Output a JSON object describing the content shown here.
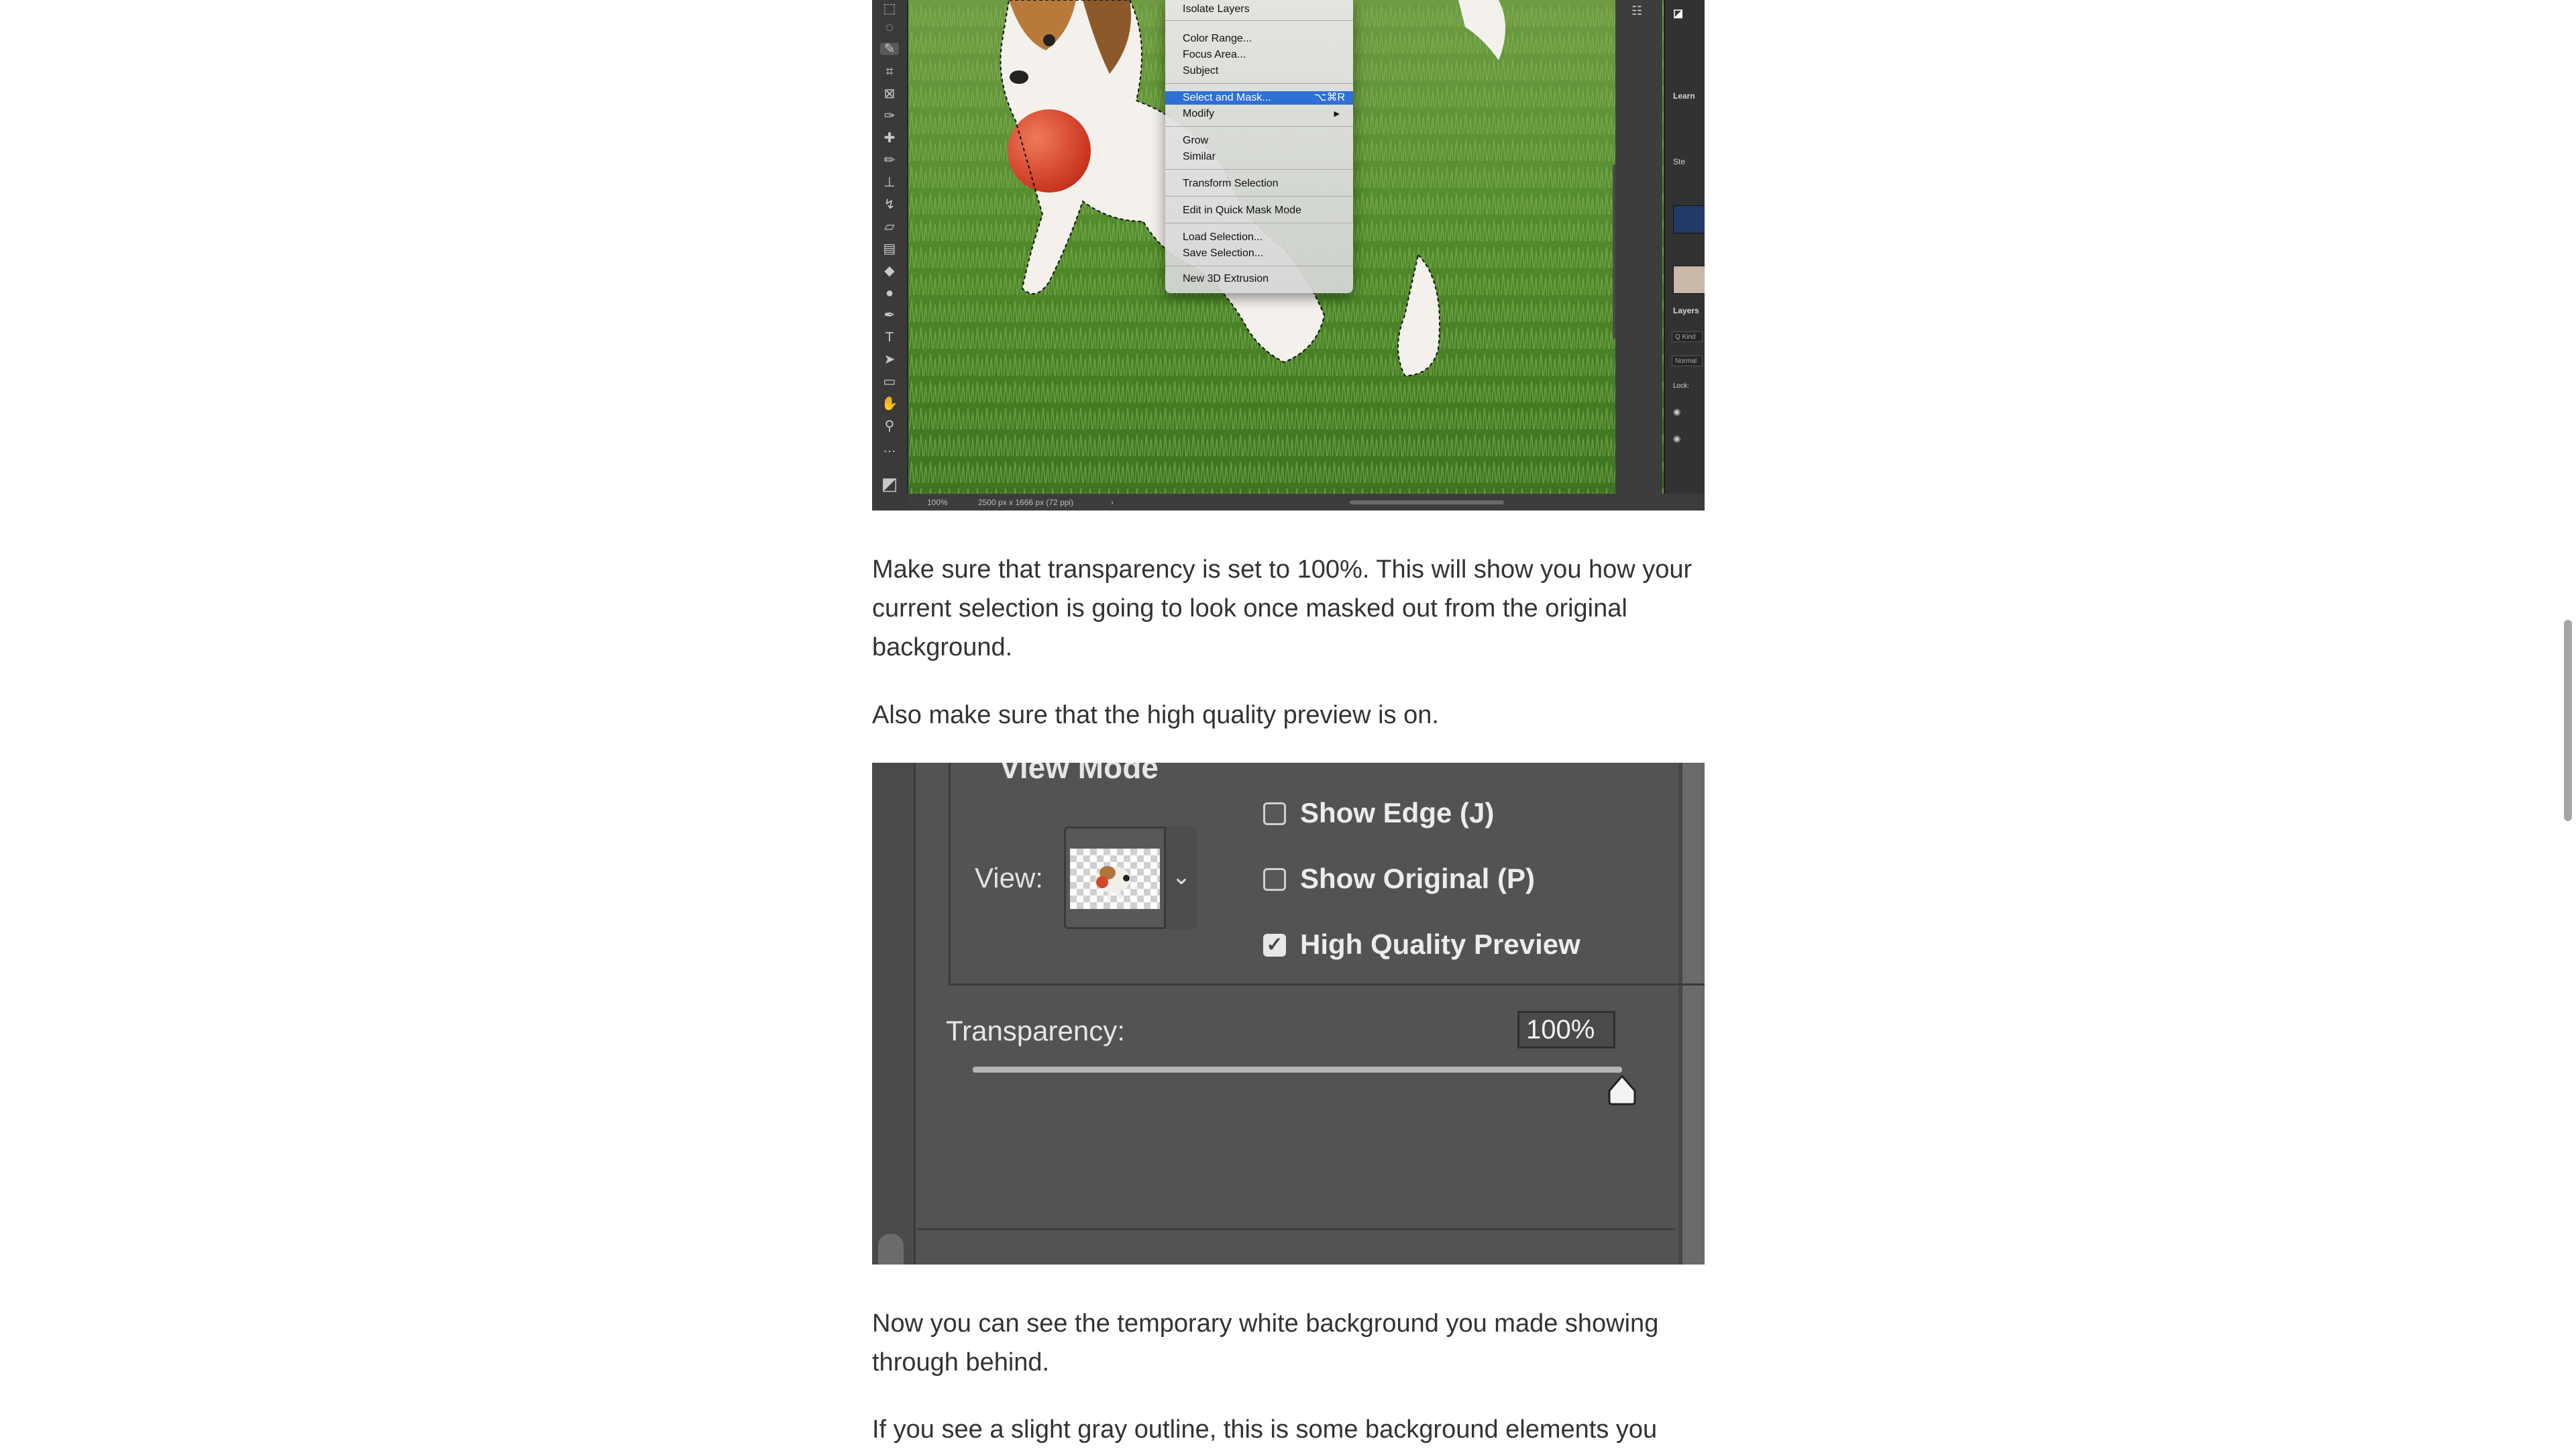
{
  "screenshot1": {
    "select_menu": {
      "items": [
        "Isolate Layers",
        "Color Range...",
        "Focus Area...",
        "Subject",
        "Select and Mask...",
        "Modify",
        "Grow",
        "Similar",
        "Transform Selection",
        "Edit in Quick Mask Mode",
        "Load Selection...",
        "Save Selection...",
        "New 3D Extrusion"
      ],
      "highlighted_shortcut": "⌥⌘R",
      "submenu_arrow": "▶"
    },
    "statusbar": {
      "zoom": "100%",
      "doc_info": "2500 px x 1666 px (72 ppi)",
      "arrow": "›"
    },
    "right_panel": {
      "learn_label": "Learn",
      "steps_label": "Ste",
      "layers_label": "Layers",
      "kind_field": "Q Kind",
      "blend_field": "Normal",
      "lock_label": "Lock:"
    }
  },
  "paragraphs": {
    "p1": "Make sure that transparency is set to 100%. This will show you how your current selection is going to look once masked out from the original background.",
    "p2": "Also make sure that the high quality preview is on.",
    "p3": "Now you can see the temporary white background you made showing through behind.",
    "p4": "If you see a slight gray outline, this is some background elements you"
  },
  "screenshot2": {
    "view_mode_title": "View Mode",
    "view_label": "View:",
    "view_dropdown_icon": "chevron-down-icon",
    "checkboxes": [
      {
        "label": "Show Edge (J)",
        "checked": false
      },
      {
        "label": "Show Original (P)",
        "checked": false
      },
      {
        "label": "High Quality Preview",
        "checked": true
      }
    ],
    "transparency_label": "Transparency:",
    "transparency_value": "100%",
    "transparency_fraction": 1.0
  }
}
